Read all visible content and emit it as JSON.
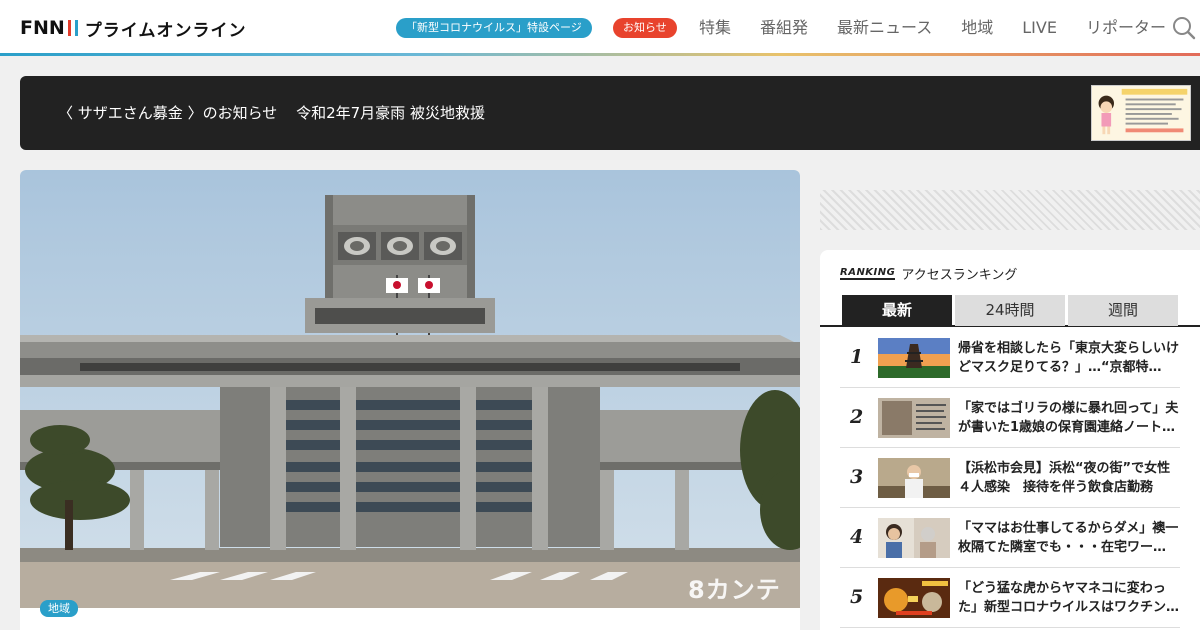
{
  "header": {
    "logo_fnn": "FNN",
    "logo_name": "プライムオンライン",
    "covid_label": "「新型コロナウイルス」特設ページ",
    "notice_label": "お知らせ",
    "nav": [
      "特集",
      "番組発",
      "最新ニュース",
      "地域",
      "LIVE",
      "リポーター"
    ],
    "search_icon": "search-icon"
  },
  "banner": {
    "left_chevron": "〈",
    "fund_name": "サザエさん募金",
    "right_chevron": "〉",
    "notice": "のお知らせ",
    "headline": "令和2年7月豪雨 被災地救援"
  },
  "hero": {
    "tag": "地域",
    "watermark": "8カンテレ"
  },
  "ranking": {
    "label_en": "RANKING",
    "label": "アクセスランキング",
    "tabs": [
      "最新",
      "24時間",
      "週間"
    ],
    "active_tab": "最新",
    "items": [
      {
        "rank": "1",
        "title": "帰省を相談したら「東京大変らしいけどマスク足りてる？」…“京都特…"
      },
      {
        "rank": "2",
        "title": "「家ではゴリラの様に暴れ回って」夫が書いた1歳娘の保育園連絡ノート…"
      },
      {
        "rank": "3",
        "title": "【浜松市会見】浜松“夜の街”で女性４人感染　接待を伴う飲食店勤務"
      },
      {
        "rank": "4",
        "title": "「ママはお仕事してるからダメ」襖一枚隔てた隣室でも・・・在宅ワー…"
      },
      {
        "rank": "5",
        "title": "「どう猛な虎からヤマネコに変わった」新型コロナウイルスはワクチン…"
      }
    ]
  },
  "colors": {
    "accent": "#2a9fc9",
    "alert": "#e8432d",
    "dark": "#222222"
  }
}
